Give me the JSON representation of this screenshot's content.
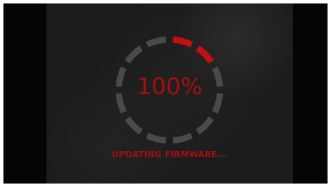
{
  "progress": {
    "value": 1.0,
    "label": "100%",
    "segments_total": 12,
    "segments_highlighted": 2,
    "segment_active_color": "#c40f0f",
    "segment_inactive_color": "#4a4a4a"
  },
  "status": {
    "text": "UPDATING FIRMWARE..."
  },
  "colors": {
    "accent": "#a80e0e",
    "frame": "#050505",
    "screen": "#1c1c1c"
  }
}
